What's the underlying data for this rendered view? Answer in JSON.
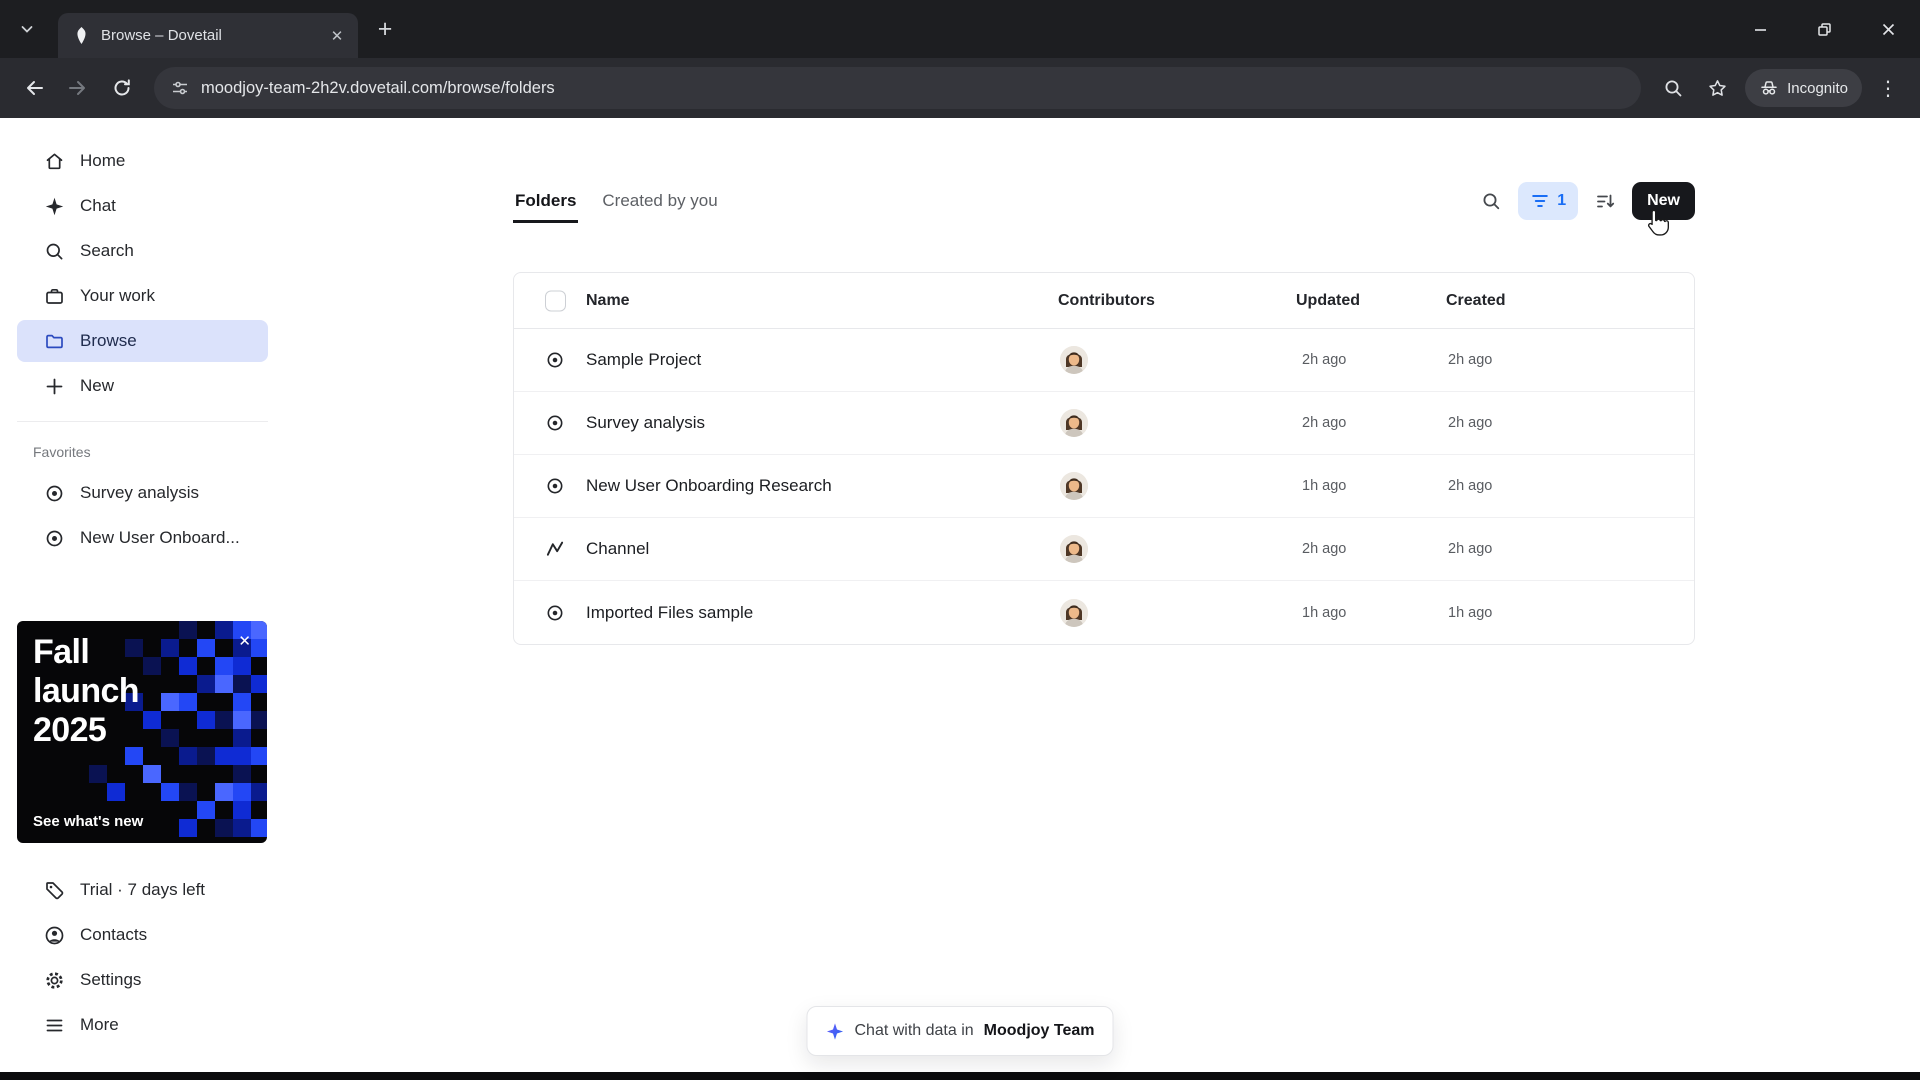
{
  "icons": {
    "close": "✕",
    "plus": "+",
    "kebab": "⋮"
  },
  "browser": {
    "tab_title": "Browse – Dovetail",
    "url": "moodjoy-team-2h2v.dovetail.com/browse/folders",
    "incognito_label": "Incognito"
  },
  "sidebar": {
    "items": [
      {
        "label": "Home",
        "icon": "home-icon"
      },
      {
        "label": "Chat",
        "icon": "sparkle-icon"
      },
      {
        "label": "Search",
        "icon": "search-icon"
      },
      {
        "label": "Your work",
        "icon": "briefcase-icon"
      },
      {
        "label": "Browse",
        "icon": "folder-icon",
        "active": true
      },
      {
        "label": "New",
        "icon": "plus-icon"
      }
    ],
    "favorites_label": "Favorites",
    "favorites": [
      {
        "label": "Survey analysis",
        "icon": "target-icon"
      },
      {
        "label": "New User Onboard...",
        "icon": "target-icon"
      }
    ],
    "promo": {
      "line1": "Fall",
      "line2": "launch",
      "line3": "2025",
      "link": "See what's new"
    },
    "footer_items": [
      {
        "label": "Trial · 7 days left",
        "icon": "tag-icon"
      },
      {
        "label": "Contacts",
        "icon": "person-icon"
      },
      {
        "label": "Settings",
        "icon": "gear-icon"
      },
      {
        "label": "More",
        "icon": "menu-icon"
      }
    ]
  },
  "main": {
    "tabs": [
      {
        "label": "Folders",
        "active": true
      },
      {
        "label": "Created by you",
        "active": false
      }
    ],
    "toolbar": {
      "filter_count": "1",
      "new_button_label": "New"
    },
    "table": {
      "columns": [
        "Name",
        "Contributors",
        "Updated",
        "Created"
      ],
      "rows": [
        {
          "name": "Sample Project",
          "icon": "target-icon",
          "updated": "2h ago",
          "created": "2h ago"
        },
        {
          "name": "Survey analysis",
          "icon": "target-icon",
          "updated": "2h ago",
          "created": "2h ago"
        },
        {
          "name": "New User Onboarding Research",
          "icon": "target-icon",
          "updated": "1h ago",
          "created": "2h ago"
        },
        {
          "name": "Channel",
          "icon": "chart-line-icon",
          "updated": "2h ago",
          "created": "2h ago"
        },
        {
          "name": "Imported Files sample",
          "icon": "target-icon",
          "updated": "1h ago",
          "created": "1h ago"
        }
      ]
    },
    "chat_pill": {
      "prefix": "Chat with data in",
      "team": "Moodjoy Team"
    }
  },
  "colors": {
    "accent_blue": "#1a6ef5",
    "active_item_bg": "#dbe2fb",
    "new_button_bg": "#17181c",
    "promo_bg": "#060608"
  }
}
